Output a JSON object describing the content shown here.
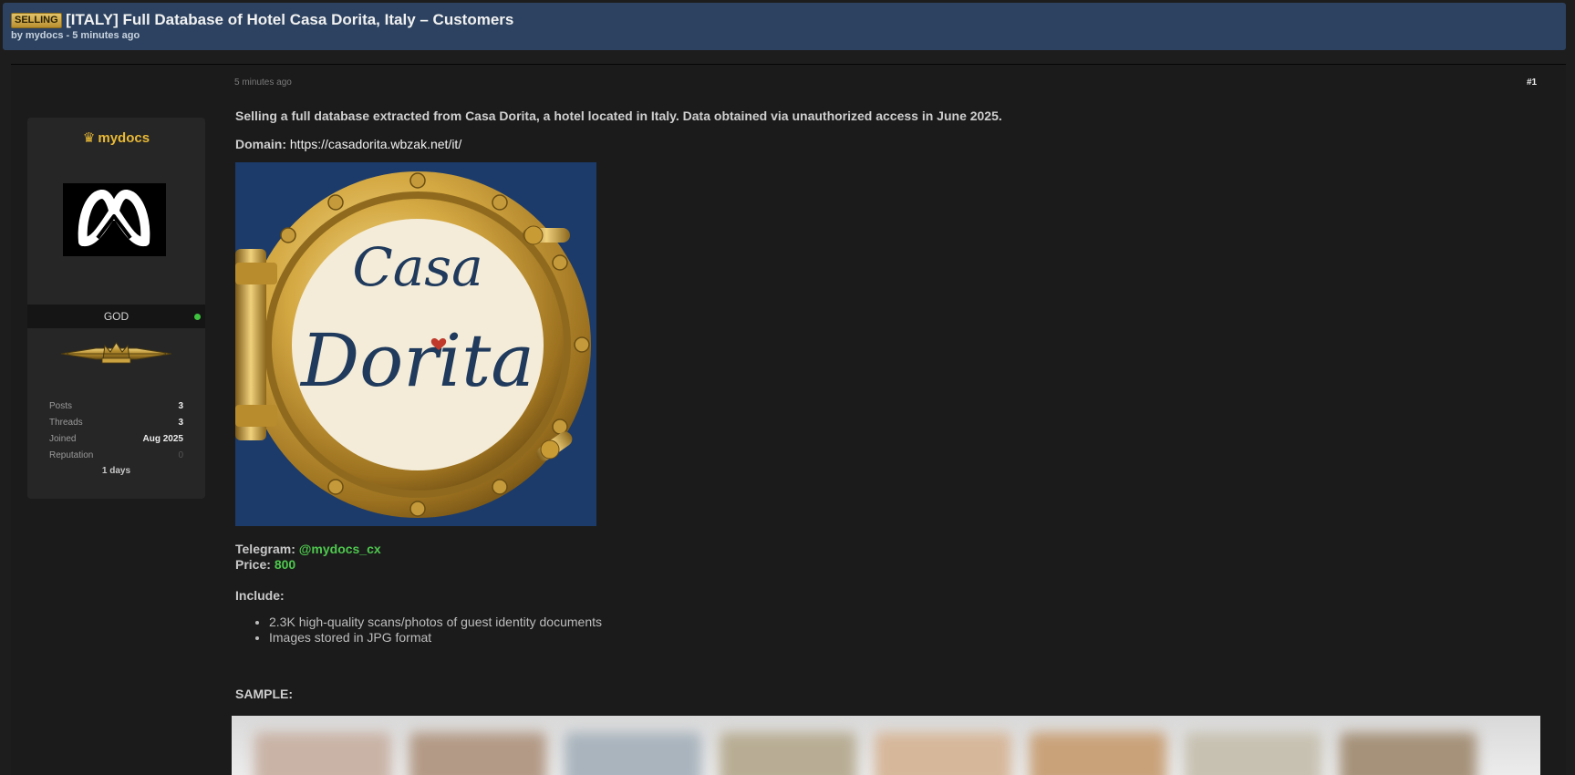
{
  "header": {
    "badge": "SELLING",
    "title": "[ITALY] Full Database of Hotel Casa Dorita, Italy – Customers",
    "meta": "by mydocs - 5 minutes ago"
  },
  "user": {
    "crown_glyph": "♛",
    "name": "mydocs",
    "rank": "GOD",
    "online": true,
    "stats": [
      {
        "label": "Posts",
        "value": "3"
      },
      {
        "label": "Threads",
        "value": "3"
      },
      {
        "label": "Joined",
        "value": "Aug 2025"
      },
      {
        "label": "Reputation",
        "value": "0"
      }
    ],
    "extra": "1 days"
  },
  "post": {
    "time": "5 minutes ago",
    "number": "#1",
    "intro": "Selling a full database extracted from Casa Dorita, a hotel located in Italy. Data obtained via unauthorized access in June 2025.",
    "domain_label": "Domain:",
    "domain_value": "https://casadorita.wbzak.net/it/",
    "image_text_line1": "Casa",
    "image_text_line2": "Dorita",
    "telegram_label": "Telegram:",
    "telegram_value": "@mydocs_cx",
    "price_label": "Price:",
    "price_value": "800",
    "include_label": "Include:",
    "include_items": [
      "2.3K high-quality scans/photos of guest identity documents",
      "Images stored in JPG format"
    ],
    "sample_label": "SAMPLE:"
  },
  "colors": {
    "header_bg": "#2c4260",
    "username": "#e8b936",
    "accent_green": "#4ec74e",
    "page_bg": "#1d1d1d"
  }
}
